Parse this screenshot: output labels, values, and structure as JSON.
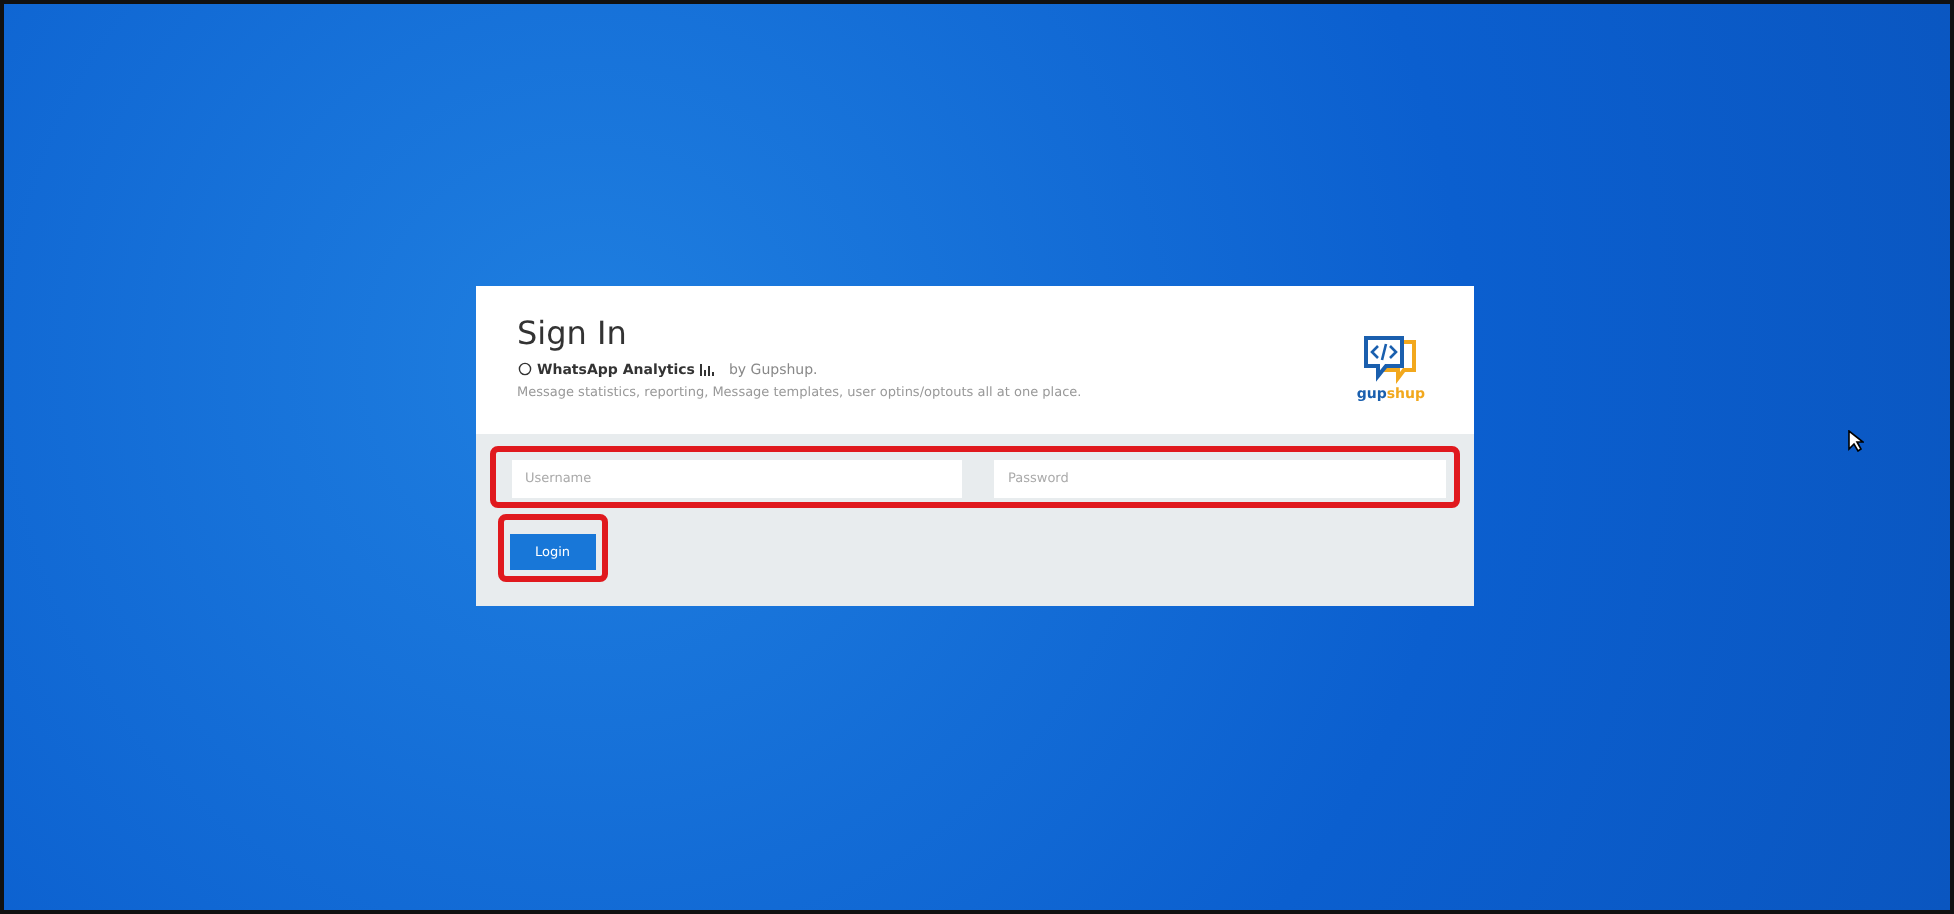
{
  "card": {
    "title": "Sign In",
    "app_name": "WhatsApp Analytics",
    "by_line": "by Gupshup.",
    "description": "Message statistics, reporting, Message templates, user optins/optouts all at one place.",
    "logo_text": [
      "gup",
      "shup"
    ]
  },
  "form": {
    "fields": [
      {
        "placeholder": "Username"
      },
      {
        "placeholder": "Password"
      }
    ],
    "button": "Login",
    "highlighted": true
  }
}
